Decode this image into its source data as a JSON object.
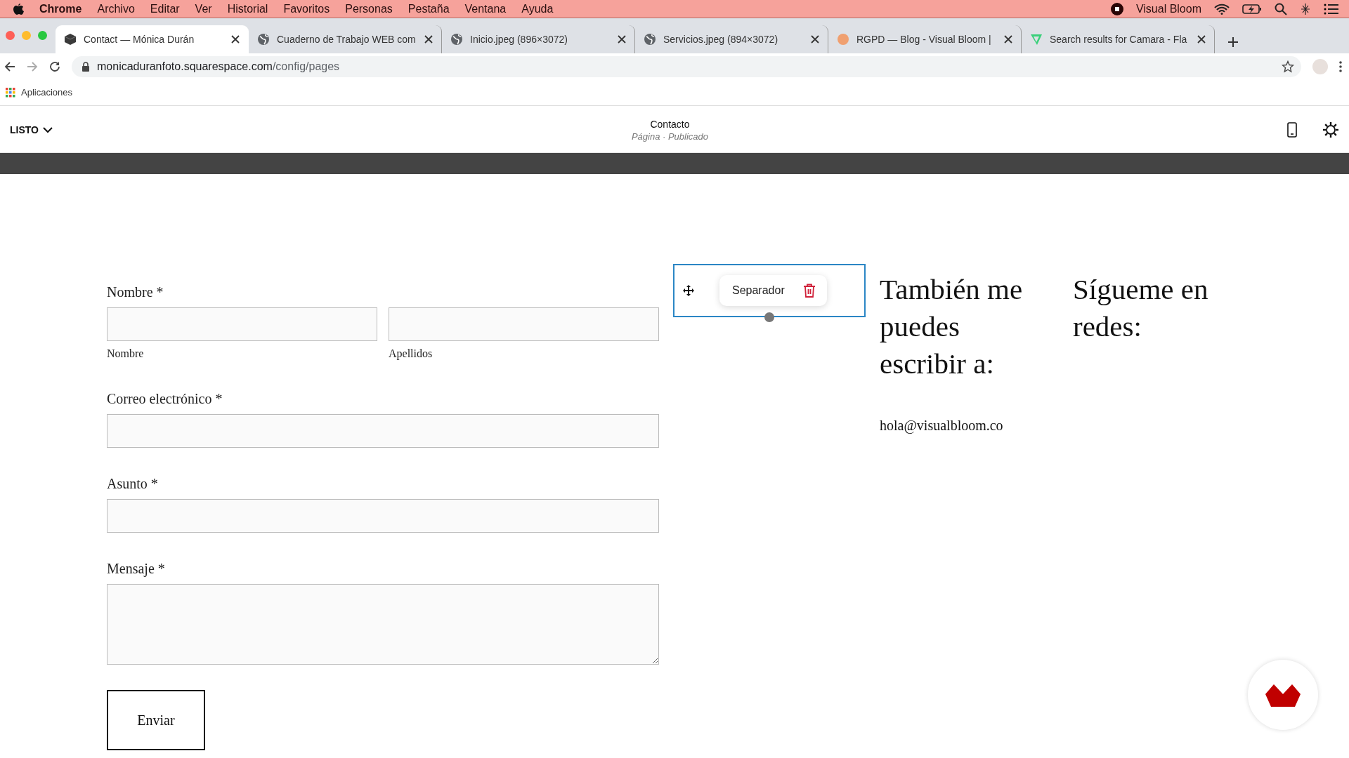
{
  "menubar": {
    "app": "Chrome",
    "items": [
      "Archivo",
      "Editar",
      "Ver",
      "Historial",
      "Favoritos",
      "Personas",
      "Pestaña",
      "Ventana",
      "Ayuda"
    ],
    "status_title": "Visual Bloom"
  },
  "tabs": [
    {
      "title": "Contact — Mónica Durán",
      "kind": "cube",
      "selected": true
    },
    {
      "title": "Cuaderno de Trabajo WEB com",
      "kind": "globe",
      "selected": false
    },
    {
      "title": "Inicio.jpeg (896×3072)",
      "kind": "globe",
      "selected": false
    },
    {
      "title": "Servicios.jpeg (894×3072)",
      "kind": "globe",
      "selected": false
    },
    {
      "title": "RGPD — Blog - Visual Bloom | ",
      "kind": "dot",
      "selected": false
    },
    {
      "title": "Search results for Camara - Fla",
      "kind": "v",
      "selected": false
    }
  ],
  "address": {
    "host": "monicaduranfoto.squarespace.com",
    "path": "/config/pages"
  },
  "bookmarks": [
    "Aplicaciones"
  ],
  "editor": {
    "done_label": "LISTO",
    "page_title": "Contacto",
    "page_subtitle": "Página · Publicado"
  },
  "form": {
    "fields": [
      {
        "kind": "pair",
        "label": "Nombre *",
        "sublabels": [
          "Nombre",
          "Apellidos"
        ]
      },
      {
        "kind": "input",
        "label": "Correo electrónico *"
      },
      {
        "kind": "input",
        "label": "Asunto *"
      },
      {
        "kind": "textarea",
        "label": "Mensaje *"
      }
    ],
    "submit": "Enviar"
  },
  "separator_block": {
    "label": "Separador"
  },
  "contact_column": {
    "heading": "También me puedes escribir a:",
    "email": "hola@visualbloom.co"
  },
  "social_column": {
    "heading": "Sígueme en redes:"
  }
}
